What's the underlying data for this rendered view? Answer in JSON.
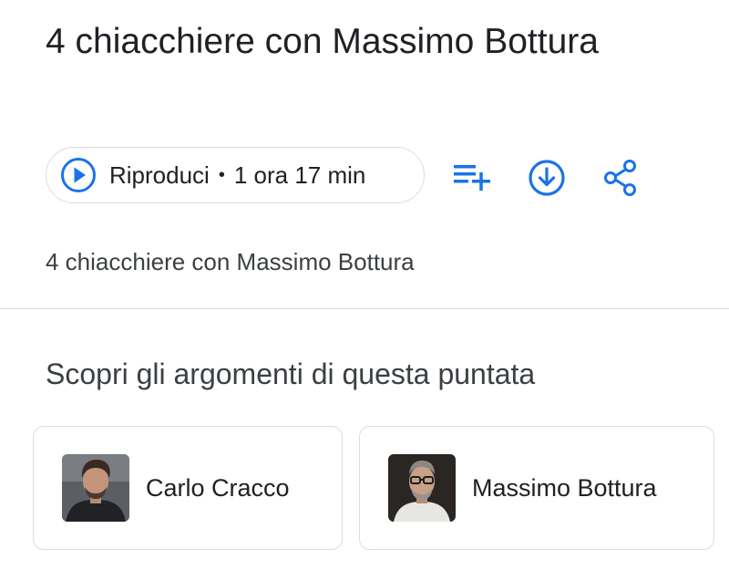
{
  "episode": {
    "title": "4 chiacchiere con Massimo Bottura",
    "description": "4 chiacchiere con Massimo Bottura"
  },
  "play_button": {
    "label": "Riproduci",
    "separator": "•",
    "duration": "1 ora 17 min"
  },
  "actions": [
    {
      "icon": "playlist-add-icon"
    },
    {
      "icon": "download-icon"
    },
    {
      "icon": "share-icon"
    }
  ],
  "topics": {
    "heading": "Scopri gli argomenti di questa puntata",
    "items": [
      {
        "name": "Carlo Cracco",
        "avatar": "person-photo"
      },
      {
        "name": "Massimo Bottura",
        "avatar": "person-photo"
      }
    ]
  },
  "colors": {
    "accent": "#1a73e8",
    "text_primary": "#202124",
    "text_secondary": "#3c4043",
    "border": "#dadce0"
  }
}
